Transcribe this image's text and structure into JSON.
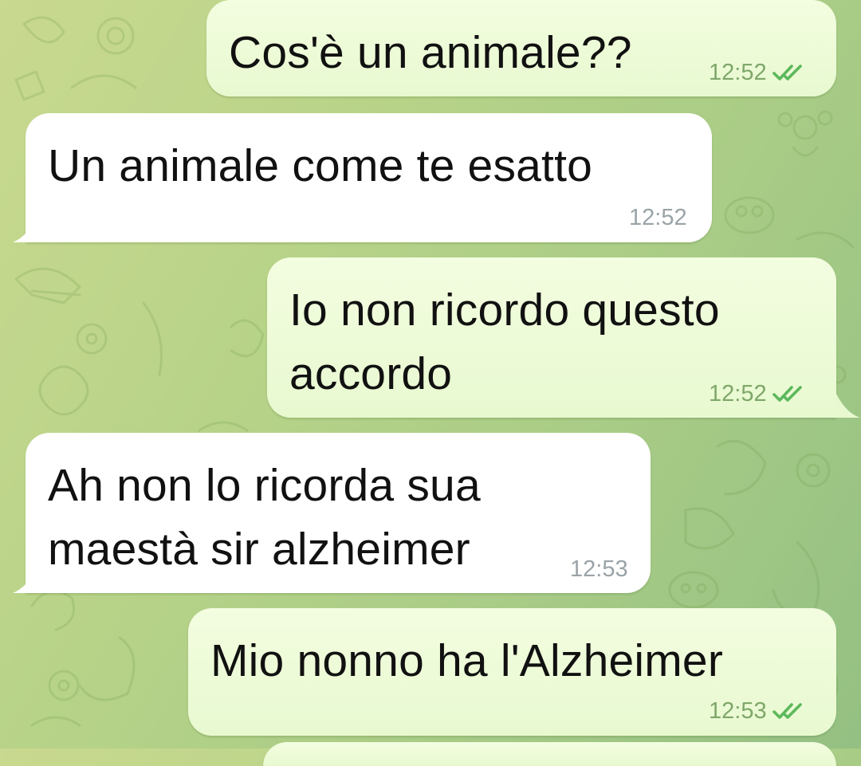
{
  "chat": {
    "messages": [
      {
        "direction": "out",
        "text_lines": [
          "Cos'è un animale??"
        ],
        "time": "12:52",
        "status": "read-double-check-icon"
      },
      {
        "direction": "in",
        "text_lines": [
          "Un animale come te esatto"
        ],
        "time": "12:52"
      },
      {
        "direction": "out",
        "text_lines": [
          "Io non ricordo questo",
          "accordo"
        ],
        "time": "12:52",
        "status": "read-double-check-icon"
      },
      {
        "direction": "in",
        "text_lines": [
          "Ah non lo ricorda sua",
          "maestà sir alzheimer"
        ],
        "time": "12:53"
      },
      {
        "direction": "out",
        "text_lines": [
          "Mio nonno ha l'Alzheimer"
        ],
        "time": "12:53",
        "status": "read-double-check-icon"
      }
    ]
  },
  "colors": {
    "outgoing_bubble": "#eefbd8",
    "incoming_bubble": "#ffffff",
    "read_check": "#5cb85c",
    "wallpaper": "#b7d388"
  }
}
